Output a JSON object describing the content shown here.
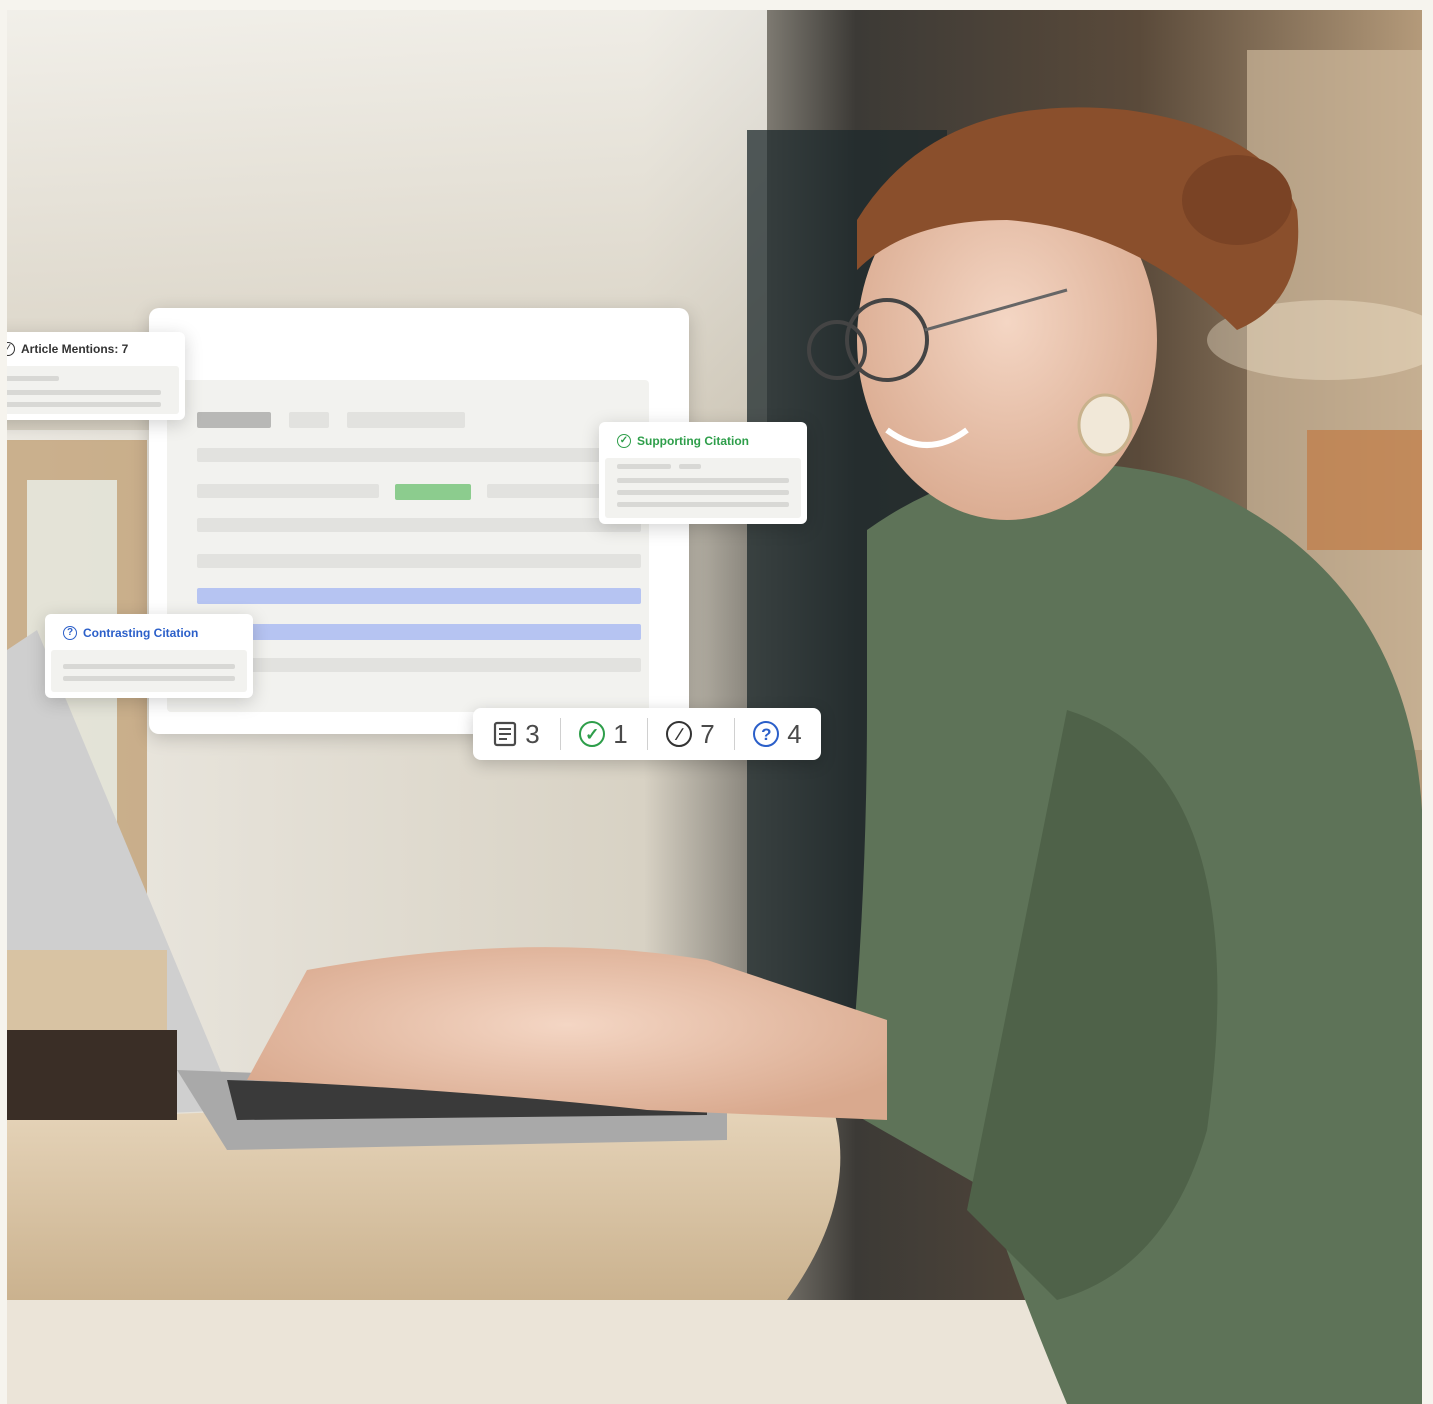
{
  "article_mentions_card": {
    "label": "Article Mentions: 7"
  },
  "supporting_card": {
    "label": "Supporting Citation"
  },
  "contrasting_card": {
    "label": "Contrasting Citation"
  },
  "toolbar": {
    "counts": [
      {
        "icon": "document-icon",
        "value": "3"
      },
      {
        "icon": "check-circle-icon",
        "value": "1"
      },
      {
        "icon": "slash-circle-icon",
        "value": "7"
      },
      {
        "icon": "question-circle-icon",
        "value": "4"
      }
    ]
  },
  "colors": {
    "supporting": "#2e9e4a",
    "contrasting": "#2b5fc9",
    "highlight_green": "#8ccc8e",
    "highlight_blue": "#b6c4f2",
    "neutral": "#333333"
  }
}
